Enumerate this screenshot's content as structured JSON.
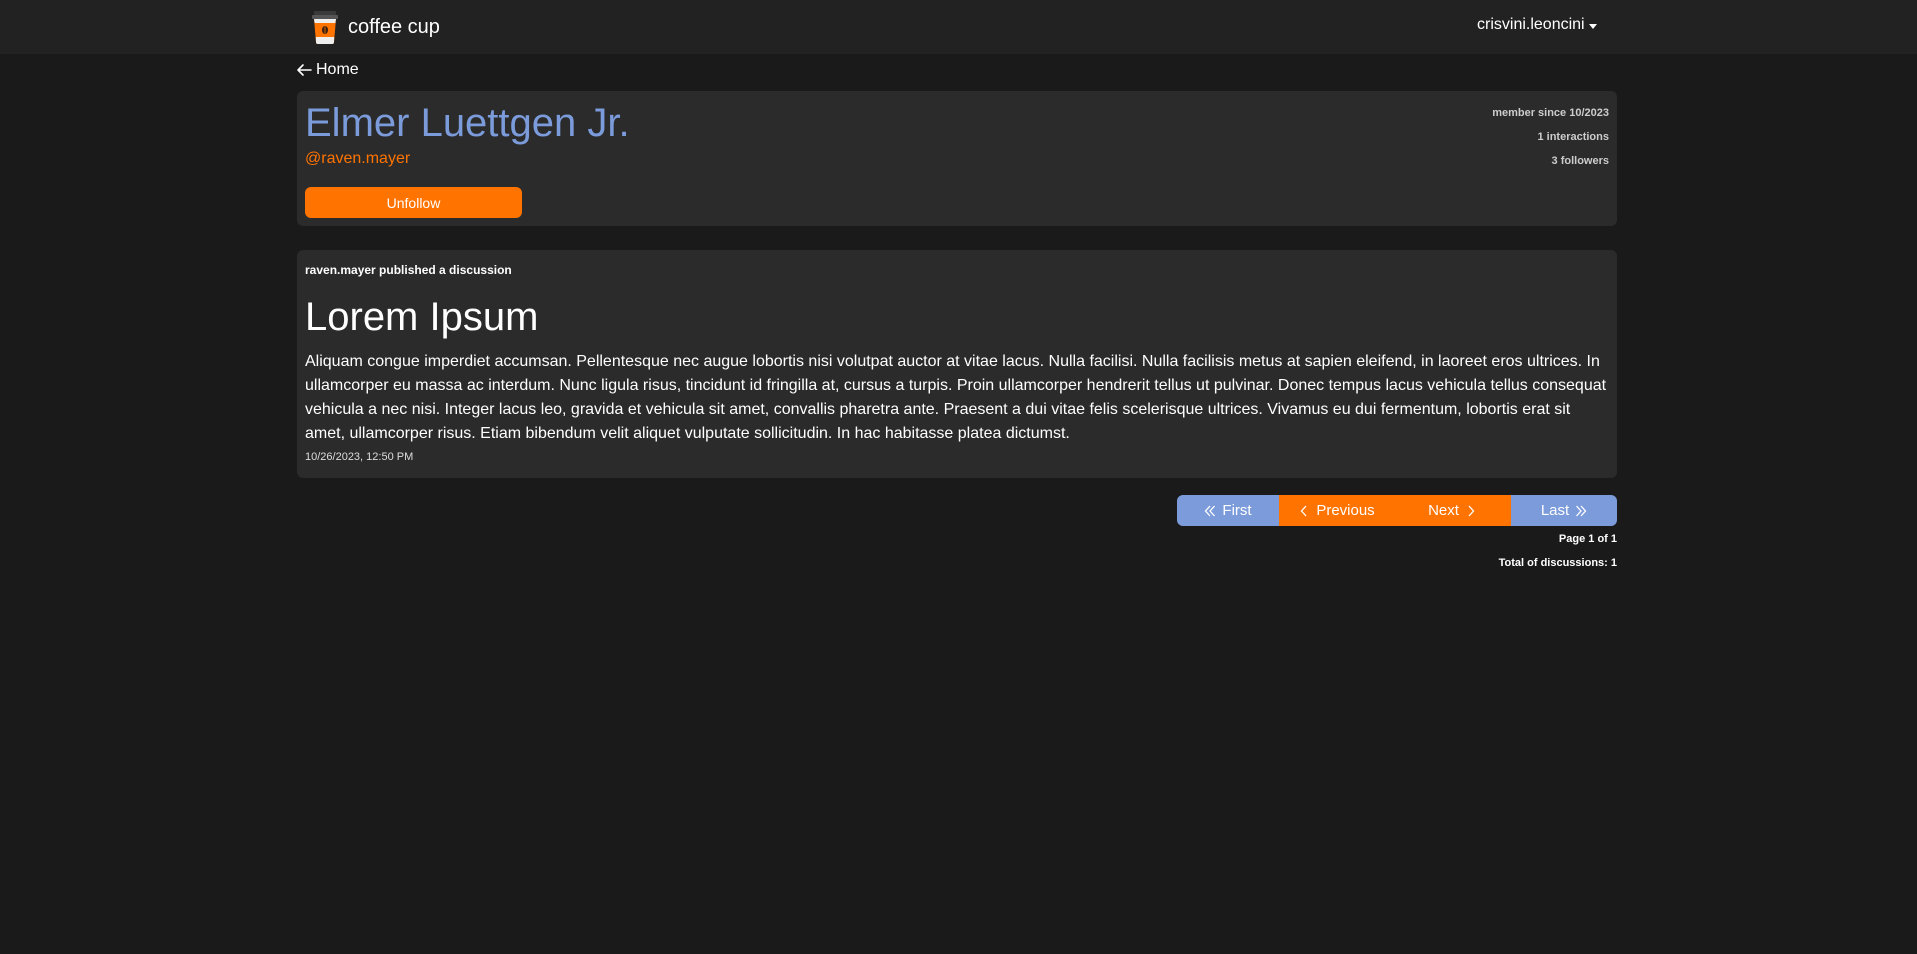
{
  "app": {
    "brand_name": "coffee cup",
    "logo_icon": "coffee-cup-icon"
  },
  "user_menu": {
    "username": "crisvini.leoncini"
  },
  "nav": {
    "back_label": "Home"
  },
  "profile": {
    "name": "Elmer Luettgen Jr.",
    "handle": "@raven.mayer",
    "follow_button_label": "Unfollow",
    "member_since": "member since 10/2023",
    "interactions": "1 interactions",
    "followers": "3 followers"
  },
  "discussions": [
    {
      "meta": "raven.mayer published a discussion",
      "title": "Lorem Ipsum",
      "body": "Aliquam congue imperdiet accumsan. Pellentesque nec augue lobortis nisi volutpat auctor at vitae lacus. Nulla facilisi. Nulla facilisis metus at sapien eleifend, in laoreet eros ultrices. In ullamcorper eu massa ac interdum. Nunc ligula risus, tincidunt id fringilla at, cursus a turpis. Proin ullamcorper hendrerit tellus ut pulvinar. Donec tempus lacus vehicula tellus consequat vehicula a nec nisi. Integer lacus leo, gravida et vehicula sit amet, convallis pharetra ante. Praesent a dui vitae felis scelerisque ultrices. Vivamus eu dui fermentum, lobortis erat sit amet, ullamcorper risus. Etiam bibendum velit aliquet vulputate sollicitudin. In hac habitasse platea dictumst.",
      "date": "10/26/2023, 12:50 PM"
    }
  ],
  "pagination": {
    "first_label": "First",
    "previous_label": "Previous",
    "next_label": "Next",
    "last_label": "Last",
    "page_info": "Page 1 of 1",
    "total_info": "Total of discussions: 1"
  },
  "colors": {
    "accent_orange": "#ff7300",
    "accent_blue": "#7b9bdb",
    "background": "#1a1a1a",
    "card": "#2b2b2b"
  }
}
